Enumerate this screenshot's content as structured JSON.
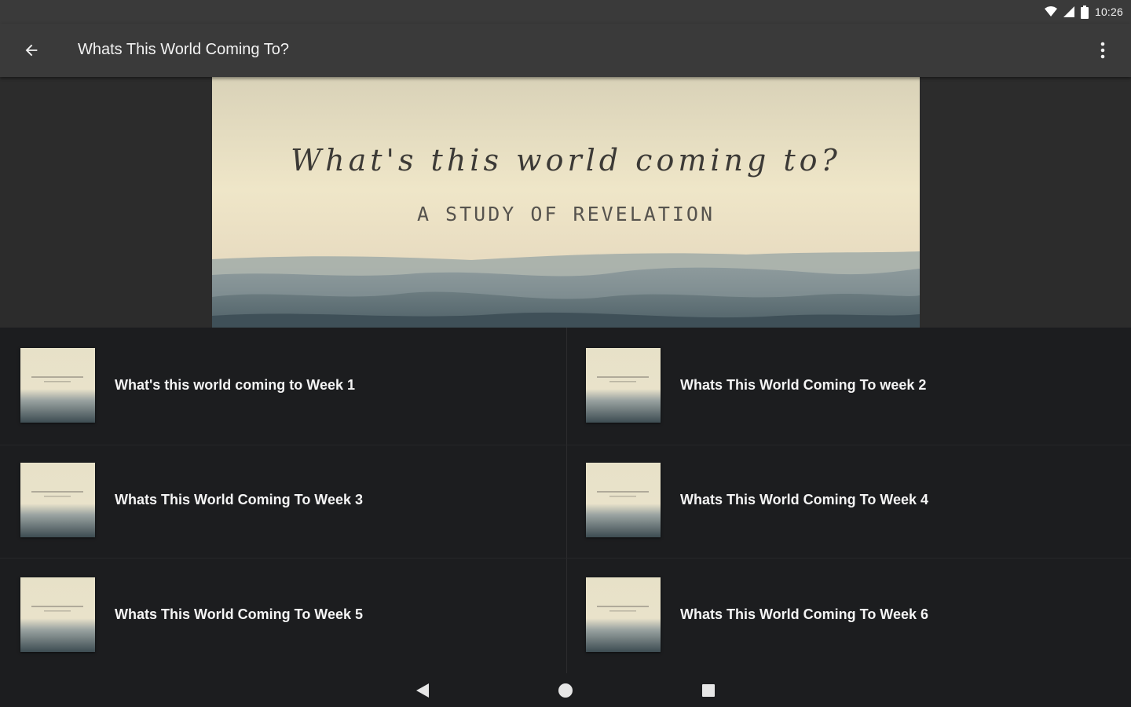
{
  "status_bar": {
    "time": "10:26",
    "icons": [
      "wifi-icon",
      "cell-signal-icon",
      "battery-icon"
    ]
  },
  "app_bar": {
    "title": "Whats This World Coming To?",
    "back_icon": "arrow-back-icon",
    "overflow_icon": "more-vert-icon"
  },
  "hero": {
    "title": "What's this world coming to?",
    "subtitle": "A STUDY OF REVELATION"
  },
  "items": [
    {
      "label": "What's this world coming to Week 1"
    },
    {
      "label": "Whats This World Coming To week 2"
    },
    {
      "label": "Whats This World Coming To Week 3"
    },
    {
      "label": "Whats This World Coming To Week 4"
    },
    {
      "label": "Whats This World Coming To Week 5"
    },
    {
      "label": "Whats This World Coming To Week 6"
    }
  ],
  "nav_bar": {
    "icons": [
      "back-triangle-icon",
      "home-circle-icon",
      "recents-square-icon"
    ]
  },
  "colors": {
    "app_bar": "#3a3a3a",
    "list_background": "#1c1d1f",
    "text_primary": "#f4f4f4"
  }
}
